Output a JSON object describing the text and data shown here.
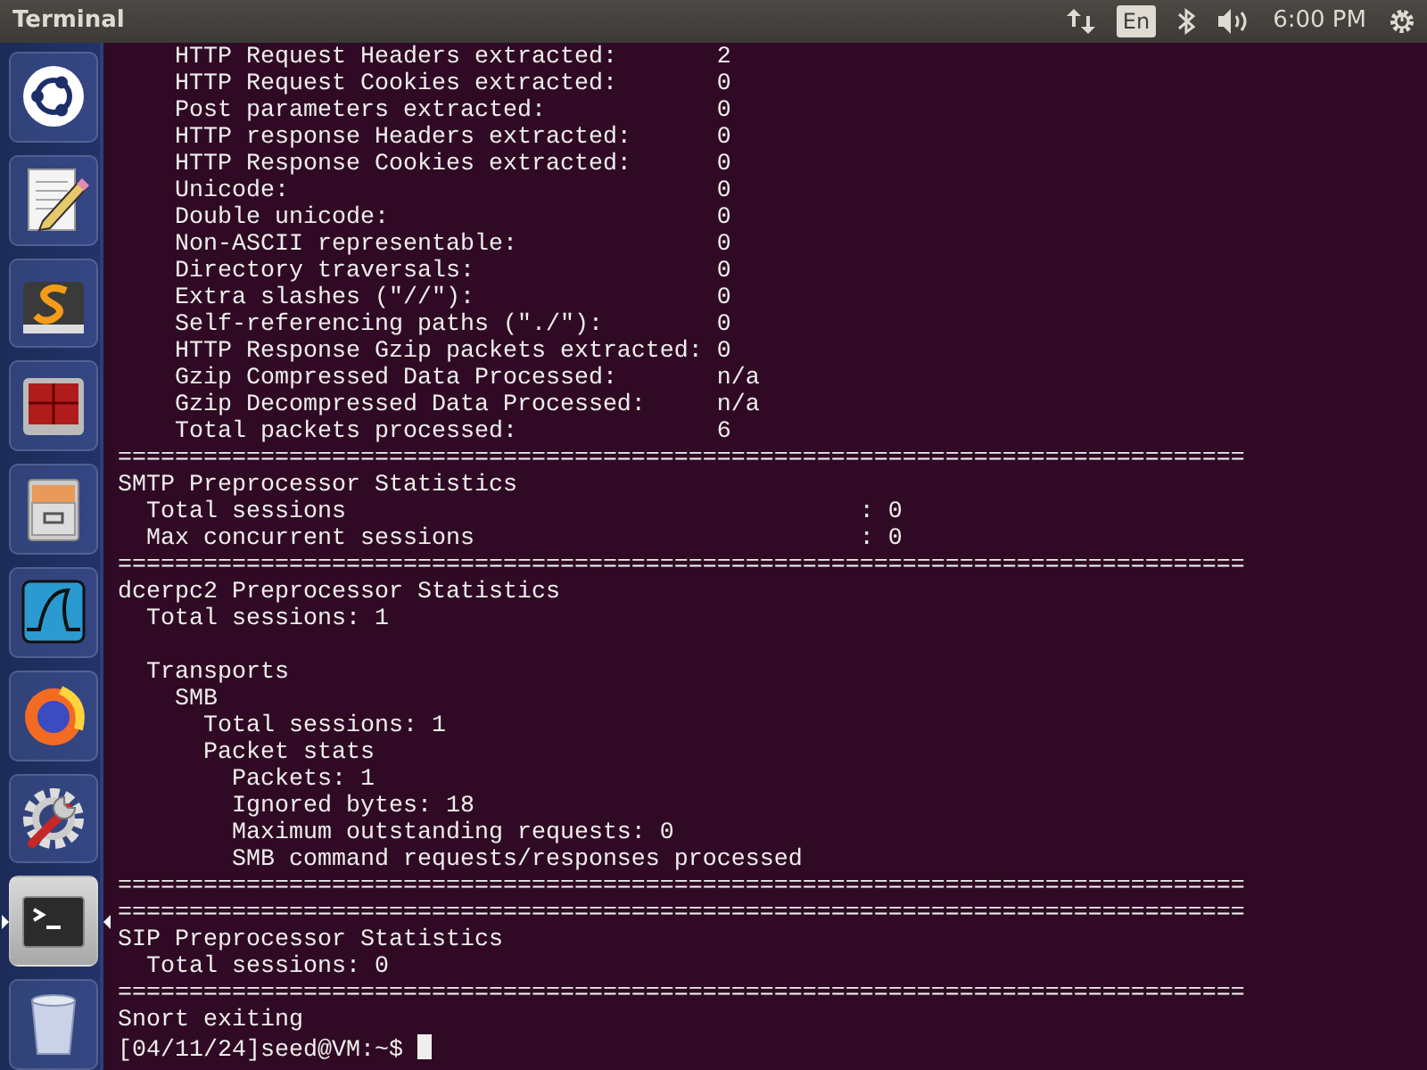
{
  "top_bar": {
    "title": "Terminal",
    "keyboard_layout": "En",
    "clock": "6:00 PM"
  },
  "launcher": [
    {
      "kind": "dash",
      "selected": false
    },
    {
      "kind": "editor",
      "selected": false
    },
    {
      "kind": "sublime",
      "selected": false
    },
    {
      "kind": "panes",
      "selected": false
    },
    {
      "kind": "files",
      "selected": false
    },
    {
      "kind": "wireshark",
      "selected": false
    },
    {
      "kind": "firefox",
      "selected": false
    },
    {
      "kind": "settings",
      "selected": false
    },
    {
      "kind": "terminal",
      "selected": true
    },
    {
      "kind": "trash",
      "selected": false
    }
  ],
  "terminal": {
    "lines": [
      {
        "kind": "text",
        "text": "    HTTP Request Headers extracted:       2"
      },
      {
        "kind": "text",
        "text": "    HTTP Request Cookies extracted:       0"
      },
      {
        "kind": "text",
        "text": "    Post parameters extracted:            0"
      },
      {
        "kind": "text",
        "text": "    HTTP response Headers extracted:      0"
      },
      {
        "kind": "text",
        "text": "    HTTP Response Cookies extracted:      0"
      },
      {
        "kind": "text",
        "text": "    Unicode:                              0"
      },
      {
        "kind": "text",
        "text": "    Double unicode:                       0"
      },
      {
        "kind": "text",
        "text": "    Non-ASCII representable:              0"
      },
      {
        "kind": "text",
        "text": "    Directory traversals:                 0"
      },
      {
        "kind": "text",
        "text": "    Extra slashes (\"//\"):                 0"
      },
      {
        "kind": "text",
        "text": "    Self-referencing paths (\"./\"):        0"
      },
      {
        "kind": "text",
        "text": "    HTTP Response Gzip packets extracted: 0"
      },
      {
        "kind": "text",
        "text": "    Gzip Compressed Data Processed:       n/a"
      },
      {
        "kind": "text",
        "text": "    Gzip Decompressed Data Processed:     n/a"
      },
      {
        "kind": "text",
        "text": "    Total packets processed:              6"
      },
      {
        "kind": "text",
        "text": "==============================================================================="
      },
      {
        "kind": "text",
        "text": "SMTP Preprocessor Statistics"
      },
      {
        "kind": "text",
        "text": "  Total sessions                                    : 0"
      },
      {
        "kind": "text",
        "text": "  Max concurrent sessions                           : 0"
      },
      {
        "kind": "text",
        "text": "==============================================================================="
      },
      {
        "kind": "text",
        "text": "dcerpc2 Preprocessor Statistics"
      },
      {
        "kind": "text",
        "text": "  Total sessions: 1"
      },
      {
        "kind": "blank"
      },
      {
        "kind": "text",
        "text": "  Transports"
      },
      {
        "kind": "text",
        "text": "    SMB"
      },
      {
        "kind": "text",
        "text": "      Total sessions: 1"
      },
      {
        "kind": "text",
        "text": "      Packet stats"
      },
      {
        "kind": "text",
        "text": "        Packets: 1"
      },
      {
        "kind": "text",
        "text": "        Ignored bytes: 18"
      },
      {
        "kind": "text",
        "text": "        Maximum outstanding requests: 0"
      },
      {
        "kind": "text",
        "text": "        SMB command requests/responses processed"
      },
      {
        "kind": "text",
        "text": "==============================================================================="
      },
      {
        "kind": "text",
        "text": "==============================================================================="
      },
      {
        "kind": "text",
        "text": "SIP Preprocessor Statistics"
      },
      {
        "kind": "text",
        "text": "  Total sessions: 0"
      },
      {
        "kind": "text",
        "text": "==============================================================================="
      },
      {
        "kind": "text",
        "text": "Snort exiting"
      },
      {
        "kind": "prompt",
        "text": "[04/11/24]seed@VM:~$ "
      }
    ]
  }
}
